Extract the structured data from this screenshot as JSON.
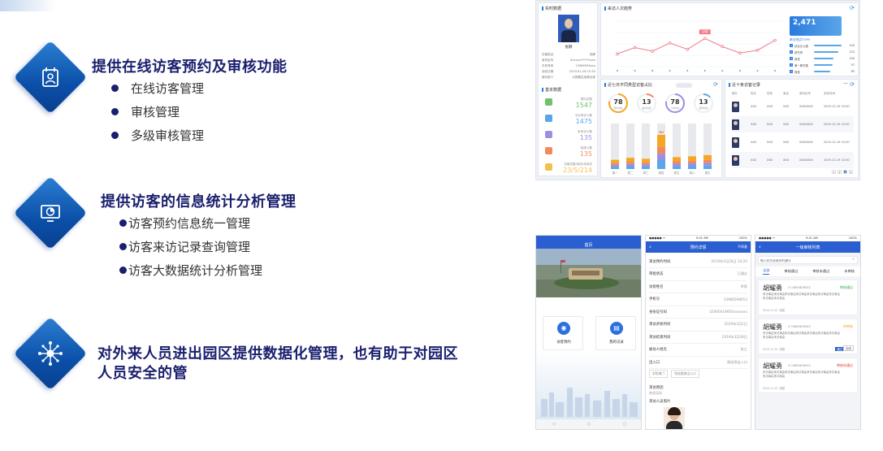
{
  "features": [
    {
      "title": "提供在线访客预约及审核功能",
      "icon": "calendar-person-icon",
      "bullets": [
        "在线访客管理",
        "审核管理",
        "多级审核管理"
      ]
    },
    {
      "title": "提供访客的信息统计分析管理",
      "icon": "chart-monitor-icon",
      "bullets": [
        "访客预约信息统一管理",
        "访客来访记录查询管理",
        "访客大数据统计分析管理"
      ]
    },
    {
      "title_line1": "对外来人员进出园区提供数据化管理，也有助于对园区",
      "title_line2": "人员安全的管",
      "icon": "network-hub-icon"
    }
  ],
  "dashboard": {
    "profile": {
      "header": "实时数据",
      "name": "张静",
      "rows": [
        {
          "k": "访客姓名",
          "v": "张静"
        },
        {
          "k": "身份证号",
          "v": "42xxxx7****xxxx"
        },
        {
          "k": "手机号码",
          "v": "13986598xxx"
        },
        {
          "k": "到访日期",
          "v": "2019-01-28 15:30"
        },
        {
          "k": "被访部门",
          "v": "大数据应用事业部"
        }
      ],
      "stats_header": "基本数据",
      "stats": [
        {
          "label": "预约总数",
          "value": "1547",
          "color": "#6cc36c"
        },
        {
          "label": "今日来访人数",
          "value": "1475",
          "color": "#5aa6e8"
        },
        {
          "label": "未来访人数",
          "value": "135",
          "color": "#9c8fe0"
        },
        {
          "label": "拒绝人数",
          "value": "135",
          "color": "#f08a5d"
        },
        {
          "label": "访客总数/到访/未到访",
          "value": "23/5/214",
          "color": "#f3c04e"
        }
      ]
    },
    "trend": {
      "title": "来访人次趋势",
      "big_number": "2,471",
      "top_title": "来访地点TOP5",
      "top": [
        {
          "name": "综合办公楼",
          "value": "140",
          "p": 0.95
        },
        {
          "name": "研究所",
          "value": "120",
          "p": 0.82
        },
        {
          "name": "食堂",
          "value": "100",
          "p": 0.68
        },
        {
          "name": "第一教学楼",
          "value": "97",
          "p": 0.64
        },
        {
          "name": "宿舍",
          "value": "85",
          "p": 0.55
        }
      ],
      "tooltip": "140",
      "line_points": [
        0.28,
        0.42,
        0.34,
        0.52,
        0.38,
        0.62,
        0.44,
        0.3,
        0.36,
        0.58
      ]
    },
    "gauges_card": {
      "title": "近七日不同类型访客占比",
      "gauges": [
        {
          "value": "78",
          "label": "预约访客",
          "color": "#f5a623",
          "p": 0.78
        },
        {
          "value": "13",
          "label": "临时访客",
          "color": "#f08a5d",
          "p": 0.13
        },
        {
          "value": "78",
          "label": "VIP访客",
          "color": "#9c8fe0",
          "p": 0.78
        },
        {
          "value": "13",
          "label": "其他访客",
          "color": "#5aa6e8",
          "p": 0.13
        }
      ],
      "bar_peak_label": "562",
      "bars": [
        0.45,
        0.55,
        0.5,
        0.75,
        0.58,
        0.62,
        0.68
      ],
      "days": [
        "周一",
        "周二",
        "周三",
        "周四",
        "周五",
        "周六",
        "周日"
      ]
    },
    "table_card": {
      "title": "近十条访客记录",
      "headers": [
        "照片",
        "姓名",
        "性别",
        "事由",
        "身份证号",
        "到访时间"
      ],
      "rows": [
        {
          "name": "XXX",
          "sex": "XXX",
          "reason": "XXX",
          "id": "XXXXXXX",
          "time": "2019-12-19 10:00"
        },
        {
          "name": "XXX",
          "sex": "XXX",
          "reason": "XXX",
          "id": "XXXXXXX",
          "time": "2019-12-19 10:00"
        },
        {
          "name": "XXX",
          "sex": "XXX",
          "reason": "XXX",
          "id": "XXXXXXX",
          "time": "2019-12-19 10:00"
        },
        {
          "name": "XXX",
          "sex": "XXX",
          "reason": "XXX",
          "id": "XXXXXXX",
          "time": "2019-12-19 10:00"
        }
      ],
      "pages": [
        "1",
        "2",
        "3",
        "4"
      ]
    }
  },
  "phone1": {
    "title": "首页",
    "actions": [
      {
        "label": "访客预约",
        "icon": "visit-booking-icon"
      },
      {
        "label": "我的记录",
        "icon": "my-records-icon"
      }
    ]
  },
  "phone2": {
    "time": "9:41 AM",
    "battery": "100%",
    "title": "预约详情",
    "status_tag": "不同意",
    "rows": [
      {
        "k": "来访预约时间",
        "v": "2019年2月28日 10:20"
      },
      {
        "k": "审批状态",
        "v": "已通过"
      },
      {
        "k": "访客姓名",
        "v": "李燕"
      },
      {
        "k": "手机号",
        "v": "13986598653"
      },
      {
        "k": "身份证号码",
        "v": "42900419950xxxxxxx"
      },
      {
        "k": "来访开始时间",
        "v": "2019年3月1日"
      },
      {
        "k": "来访结束时间",
        "v": "2019年3月28日"
      },
      {
        "k": "被访人姓名",
        "v": "张三"
      },
      {
        "k": "出入口",
        "v": "请选择出入口"
      }
    ],
    "gates": [
      "学校南门",
      "科技楼南出入口"
    ],
    "reason_label": "来访原因",
    "reason_value": "参会培训",
    "photo_label": "来访人员照片"
  },
  "phone3": {
    "time": "9:41 AM",
    "battery": "100%",
    "title": "一级审核列表",
    "search_placeholder": "输入姓名或者预约编号",
    "tabs": [
      "全部",
      "审核通过",
      "审核未通过",
      "未审核"
    ],
    "cards": [
      {
        "name": "胡耀勇",
        "phone": "13809876543",
        "status": "审核通过",
        "status_color": "#2fa84f",
        "date": "2019-11-22",
        "place": "校园"
      },
      {
        "name": "胡耀勇",
        "phone": "13809876543",
        "status": "待审核",
        "status_color": "#f5a623",
        "date": "2019-11-22",
        "place": "校园"
      },
      {
        "name": "胡耀勇",
        "phone": "13809876543",
        "status": "审核未通过",
        "status_color": "#e0352b",
        "date": "2019-11-22",
        "place": "校园"
      }
    ],
    "desc": "来访事由来访事由来访事由来访事由来访事由来访事由来访事由来访事由来访事由",
    "btn_ok": "通过",
    "btn_no": "拒绝"
  }
}
